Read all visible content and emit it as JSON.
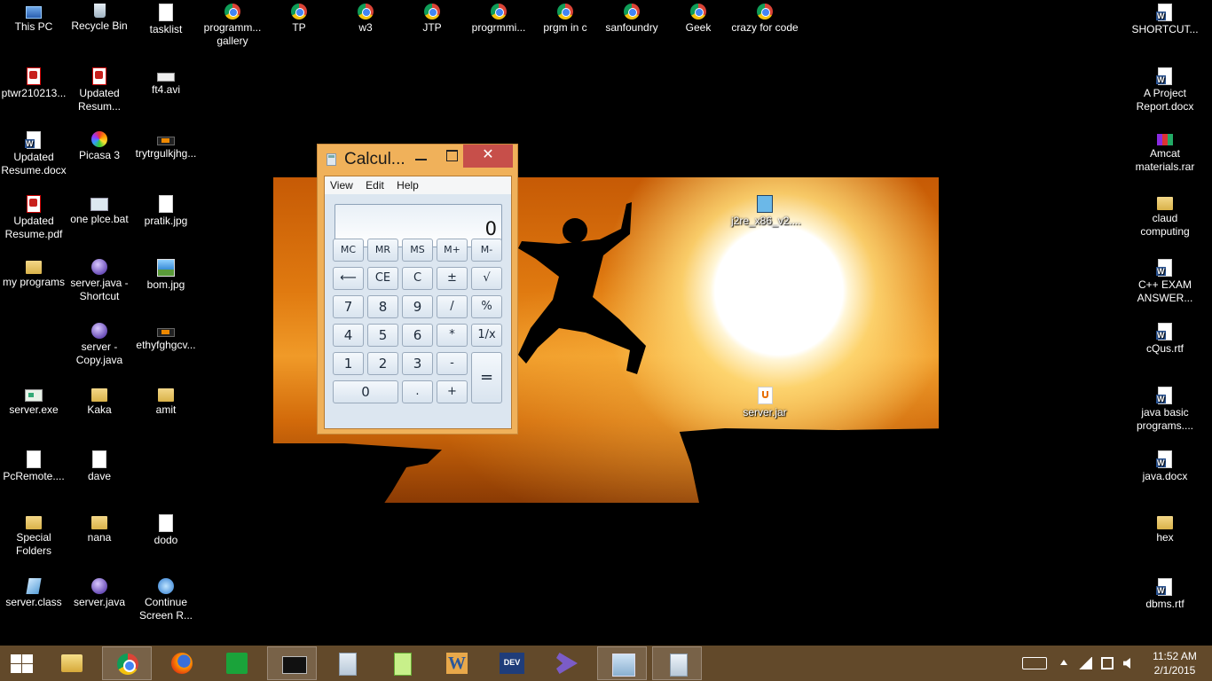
{
  "desktop_icons": [
    {
      "label": "This PC",
      "icon": "pc"
    },
    {
      "label": "Recycle Bin",
      "icon": "bin"
    },
    {
      "label": "tasklist",
      "icon": "file"
    },
    {
      "label": "programm... gallery",
      "icon": "chrome"
    },
    {
      "label": "TP",
      "icon": "chrome"
    },
    {
      "label": "w3",
      "icon": "chrome"
    },
    {
      "label": "JTP",
      "icon": "chrome"
    },
    {
      "label": "progrmmi...",
      "icon": "chrome"
    },
    {
      "label": "prgm in c",
      "icon": "chrome"
    },
    {
      "label": "sanfoundry",
      "icon": "chrome"
    },
    {
      "label": "Geek",
      "icon": "chrome"
    },
    {
      "label": "crazy for code",
      "icon": "chrome"
    },
    {
      "label": "SHORTCUT...",
      "icon": "word"
    },
    {
      "label": "ptwr210213...",
      "icon": "pdf"
    },
    {
      "label": "Updated Resum...",
      "icon": "pdf"
    },
    {
      "label": "ft4.avi",
      "icon": "avi"
    },
    {
      "label": "A Project Report.docx",
      "icon": "word"
    },
    {
      "label": "Updated Resume.docx",
      "icon": "word"
    },
    {
      "label": "Picasa 3",
      "icon": "picasa"
    },
    {
      "label": "trytrgulkjhg...",
      "icon": "orange"
    },
    {
      "label": "Amcat materials.rar",
      "icon": "rar"
    },
    {
      "label": "j2re_x86_v2....",
      "icon": "setup"
    },
    {
      "label": "Updated Resume.pdf",
      "icon": "pdf"
    },
    {
      "label": "one plce.bat",
      "icon": "bat"
    },
    {
      "label": "pratik.jpg",
      "icon": "file"
    },
    {
      "label": "claud computing",
      "icon": "folder"
    },
    {
      "label": "my programs",
      "icon": "folder"
    },
    {
      "label": "server.java - Shortcut",
      "icon": "java"
    },
    {
      "label": "bom.jpg",
      "icon": "img"
    },
    {
      "label": "C++ EXAM ANSWER...",
      "icon": "word"
    },
    {
      "label": "server - Copy.java",
      "icon": "java"
    },
    {
      "label": "ethyfghgcv...",
      "icon": "orange"
    },
    {
      "label": "cQus.rtf",
      "icon": "word"
    },
    {
      "label": "server.exe",
      "icon": "exe"
    },
    {
      "label": "Kaka",
      "icon": "folder"
    },
    {
      "label": "amit",
      "icon": "folder"
    },
    {
      "label": "server.jar",
      "icon": "jar"
    },
    {
      "label": "java basic programs....",
      "icon": "word"
    },
    {
      "label": "PcRemote....",
      "icon": "file"
    },
    {
      "label": "dave",
      "icon": "file"
    },
    {
      "label": "java.docx",
      "icon": "word"
    },
    {
      "label": "Special Folders",
      "icon": "folder"
    },
    {
      "label": "nana",
      "icon": "folder"
    },
    {
      "label": "dodo",
      "icon": "file"
    },
    {
      "label": "hex",
      "icon": "folder"
    },
    {
      "label": "server.class",
      "icon": "cls"
    },
    {
      "label": "server.java",
      "icon": "java"
    },
    {
      "label": "Continue Screen R...",
      "icon": "cont"
    },
    {
      "label": "dbms.rtf",
      "icon": "word"
    }
  ],
  "calculator": {
    "title": "Calcul...",
    "close_glyph": "✕",
    "menu": [
      "View",
      "Edit",
      "Help"
    ],
    "display": "0",
    "keys": [
      "MC",
      "MR",
      "MS",
      "M+",
      "M-",
      "⟵",
      "CE",
      "C",
      "±",
      "√",
      "7",
      "8",
      "9",
      "/",
      "%",
      "4",
      "5",
      "6",
      "*",
      "1/x",
      "1",
      "2",
      "3",
      "-",
      "=",
      "0",
      ".",
      "+"
    ]
  },
  "taskbar": {
    "apps": [
      "start-icon",
      "file-explorer-icon",
      "chrome-icon",
      "firefox-icon",
      "store-icon",
      "cmd-icon",
      "calculator-icon",
      "notepadpp-icon",
      "word-icon",
      "devcpp-icon",
      "visual-studio-icon",
      "system-monitor-icon",
      "calculator-icon"
    ],
    "clock_time": "11:52 AM",
    "clock_date": "2/1/2015"
  },
  "colors": {
    "taskbar": "#62492a",
    "calc_frame": "#f0b15a",
    "close_button": "#c74f4a"
  }
}
